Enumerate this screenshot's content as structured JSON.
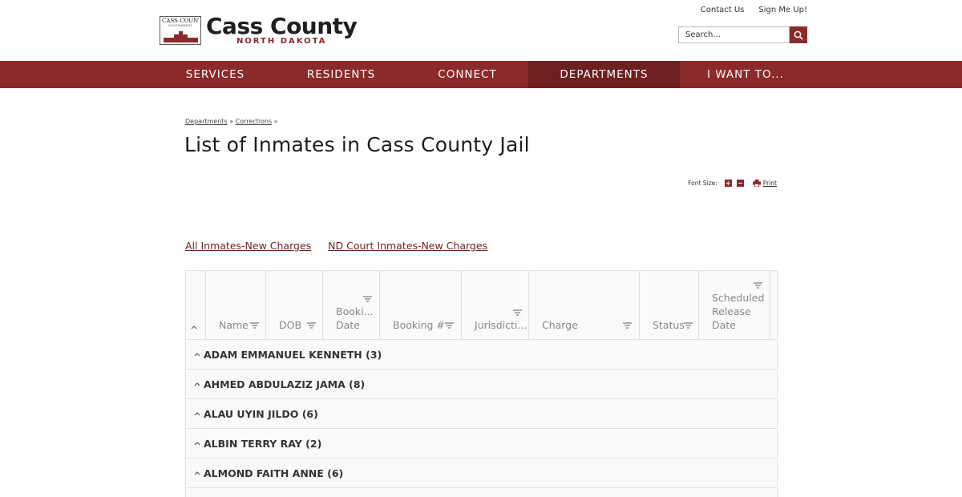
{
  "logo": {
    "badge_text": "CASS COUNTY",
    "badge_sub": "GOVERNMENT",
    "title": "Cass County",
    "subtitle": "NORTH DAKOTA"
  },
  "util_links": [
    "Contact Us",
    "Sign Me Up!"
  ],
  "search": {
    "placeholder": "Search..."
  },
  "nav": {
    "items": [
      "SERVICES",
      "RESIDENTS",
      "CONNECT",
      "DEPARTMENTS",
      "I WANT TO..."
    ],
    "active": "DEPARTMENTS"
  },
  "breadcrumb": {
    "items": [
      "Departments",
      "Corrections"
    ],
    "separator": "»"
  },
  "page": {
    "title": "List of Inmates in Cass County Jail"
  },
  "tools": {
    "font_size_label": "Font Size:",
    "increase": "+",
    "decrease": "−",
    "print_label": "Print"
  },
  "report_links": [
    "All Inmates-New Charges",
    "ND Court Inmates-New Charges"
  ],
  "grid": {
    "columns": [
      "Name",
      "DOB",
      "Booki... Date",
      "Booking #",
      "Jurisdicti...",
      "Charge",
      "Status",
      "Scheduled Release Date"
    ],
    "column_lines": [
      [
        "Name"
      ],
      [
        "DOB"
      ],
      [
        "Booki...",
        "Date"
      ],
      [
        "Booking #"
      ],
      [
        "Jurisdicti..."
      ],
      [
        "Charge"
      ],
      [
        "Status"
      ],
      [
        "Scheduled",
        "Release",
        "Date"
      ]
    ],
    "groups": [
      "ADAM EMMANUEL KENNETH (3)",
      "AHMED ABDULAZIZ JAMA (8)",
      "ALAU UYIN JILDO (6)",
      "ALBIN TERRY RAY (2)",
      "ALMOND FAITH ANNE (6)"
    ]
  },
  "colors": {
    "brand": "#8b2a2b",
    "brand_dark": "#6e1f20",
    "link": "#6e1f20",
    "grid_border": "#e2e2e2"
  }
}
